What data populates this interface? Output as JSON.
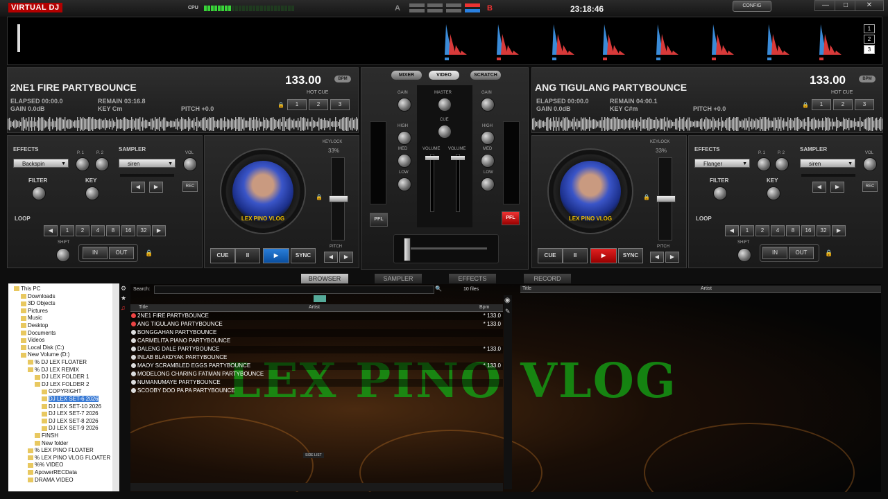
{
  "app": {
    "logo": "VIRTUAL DJ",
    "cpu_label": "CPU",
    "cpu_level": 0.3,
    "deck_a_label": "A",
    "deck_b_label": "B",
    "clock": "23:18:46",
    "config_label": "CONFIG",
    "min_label": "—",
    "max_label": "□",
    "close_label": "✕"
  },
  "rhythm": {
    "numbers": [
      "1",
      "2",
      "3"
    ],
    "selected": "3"
  },
  "deck_left": {
    "title": "2NE1 FIRE PARTYBOUNCE",
    "bpm": "133.00",
    "bpm_tag": "BPM",
    "elapsed": "ELAPSED 00:00.0",
    "remain": "REMAIN 03:16.8",
    "gain": "GAIN 0.0dB",
    "key": "KEY Cm",
    "pitch": "PITCH +0.0",
    "hotcue_label": "HOT CUE",
    "hotcues": [
      "1",
      "2",
      "3"
    ],
    "effects_label": "EFFECTS",
    "effect": "Backspin",
    "p1": "P. 1",
    "p2": "P. 2",
    "sampler_label": "SAMPLER",
    "sample": "siren",
    "vol": "VOL",
    "rec": "REC",
    "filter": "FILTER",
    "key_knob": "KEY",
    "loop_label": "LOOP",
    "loop_sizes": [
      "1",
      "2",
      "4",
      "8",
      "16",
      "32"
    ],
    "shift": "SHIFT",
    "in": "IN",
    "out": "OUT",
    "keylock": "KEYLOCK",
    "keylock_pct": "33%",
    "platter_text": "LEX PINO VLOG",
    "cue": "CUE",
    "pause": "II",
    "play": "▶",
    "sync": "SYNC",
    "pitch_label": "PITCH"
  },
  "deck_right": {
    "title": "ANG TIGULANG PARTYBOUNCE",
    "bpm": "133.00",
    "bpm_tag": "BPM",
    "elapsed": "ELAPSED 00:00.0",
    "remain": "REMAIN 04:00.1",
    "gain": "GAIN 0.0dB",
    "key": "KEY C#m",
    "pitch": "PITCH +0.0",
    "hotcue_label": "HOT CUE",
    "hotcues": [
      "1",
      "2",
      "3"
    ],
    "effects_label": "EFFECTS",
    "effect": "Flanger",
    "p1": "P. 1",
    "p2": "P. 2",
    "sampler_label": "SAMPLER",
    "sample": "siren",
    "vol": "VOL",
    "rec": "REC",
    "filter": "FILTER",
    "key_knob": "KEY",
    "loop_label": "LOOP",
    "loop_sizes": [
      "1",
      "2",
      "4",
      "8",
      "16",
      "32"
    ],
    "shift": "SHIFT",
    "in": "IN",
    "out": "OUT",
    "keylock": "KEYLOCK",
    "keylock_pct": "33%",
    "platter_text": "LEX PINO VLOG",
    "cue": "CUE",
    "pause": "II",
    "play": "▶",
    "sync": "SYNC",
    "pitch_label": "PITCH"
  },
  "mixer": {
    "tabs": [
      "MIXER",
      "VIDEO",
      "SCRATCH"
    ],
    "gain": "GAIN",
    "master": "MASTER",
    "cue": "CUE",
    "high": "HIGH",
    "med": "MED",
    "low": "LOW",
    "volume": "VOLUME",
    "pfl": "PFL"
  },
  "bottom_tabs": [
    "BROWSER",
    "SAMPLER",
    "EFFECTS",
    "RECORD"
  ],
  "browser": {
    "tree": [
      "This PC",
      "Downloads",
      "3D Objects",
      "Pictures",
      "Music",
      "Desktop",
      "Documents",
      "Videos",
      "Local Disk (C:)",
      "New Volume (D:)",
      "% DJ LEX FLOATER",
      "% DJ LEX REMIX",
      "DJ LEX FOLDER 1",
      "DJ LEX FOLDER 2",
      "COPYRIGHT",
      "DJ LEX SET-6 2026",
      "DJ LEX SET-10 2026",
      "DJ LEX SET-7 2026",
      "DJ LEX SET-8 2026",
      "DJ LEX SET-9 2026",
      "FINSH",
      "New folder",
      "% LEX PINO FLOATER",
      "% LEX PINO VLOG FLOATER",
      "%% VIDEO",
      "ApowerRECData",
      "DRAMA VIDEO"
    ],
    "tree_selected": "DJ LEX SET-6 2026",
    "search_label": "Search:",
    "file_count": "10 files",
    "columns": {
      "title": "Title",
      "artist": "Artist",
      "bpm": "Bpm"
    },
    "tracks": [
      {
        "title": "2NE1 FIRE PARTYBOUNCE",
        "bpm": "* 133.0"
      },
      {
        "title": "ANG TIGULANG PARTYBOUNCE",
        "bpm": "* 133.0"
      },
      {
        "title": "BONGGAHAN PARTYBOUNCE",
        "bpm": ""
      },
      {
        "title": "CARMELITA PIANO PARTYBOUNCE",
        "bpm": ""
      },
      {
        "title": "DALENG DALE PARTYBOUNCE",
        "bpm": "* 133.0"
      },
      {
        "title": "INLAB BLAKDYAK PARTYBOUNCE",
        "bpm": ""
      },
      {
        "title": "MAOY SCRAMBLED EGGS PARTYBOUNCE",
        "bpm": "* 133.0"
      },
      {
        "title": "MODELONG CHARING FATMAN PARTYBOUNCE",
        "bpm": ""
      },
      {
        "title": "NUMANUMAYE PARTYBOUNCE",
        "bpm": ""
      },
      {
        "title": "SCOOBY DOO PA PA PARTYBOUNCE",
        "bpm": ""
      }
    ],
    "side_list": "SIDE LIST",
    "right_columns": {
      "title": "Title",
      "artist": "Artist"
    },
    "watermark": "LEX PINO VLOG"
  }
}
